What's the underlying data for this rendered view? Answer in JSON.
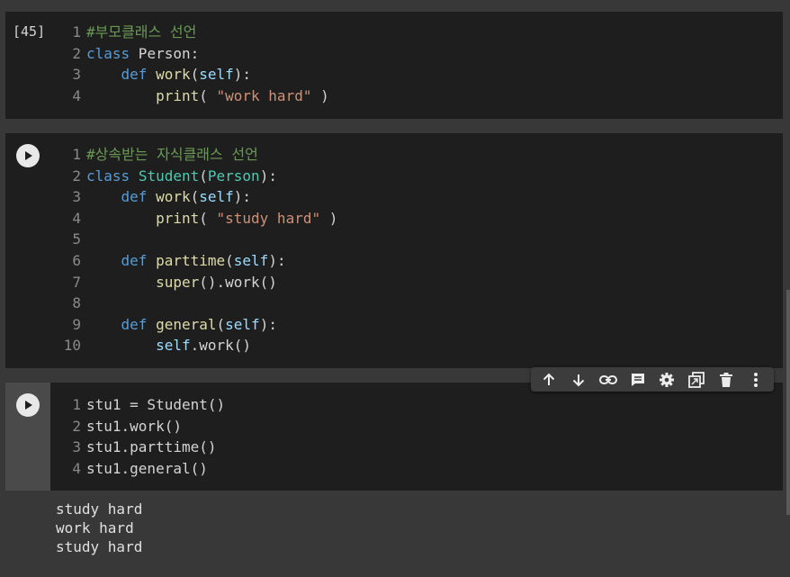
{
  "cells": [
    {
      "execution_count": "[45]",
      "lines": [
        [
          {
            "c": "cm",
            "t": "#부모클래스 선언"
          }
        ],
        [
          {
            "c": "kw",
            "t": "class"
          },
          {
            "c": "src",
            "t": " Person:"
          }
        ],
        [
          {
            "c": "src",
            "t": "    "
          },
          {
            "c": "kw",
            "t": "def"
          },
          {
            "c": "src",
            "t": " "
          },
          {
            "c": "fn",
            "t": "work"
          },
          {
            "c": "src",
            "t": "("
          },
          {
            "c": "sf",
            "t": "self"
          },
          {
            "c": "src",
            "t": "):"
          }
        ],
        [
          {
            "c": "src",
            "t": "        "
          },
          {
            "c": "fn",
            "t": "print"
          },
          {
            "c": "src",
            "t": "( "
          },
          {
            "c": "st",
            "t": "\"work hard\""
          },
          {
            "c": "src",
            "t": " )"
          }
        ]
      ]
    },
    {
      "lines": [
        [
          {
            "c": "cm",
            "t": "#상속받는 자식클래스 선언"
          }
        ],
        [
          {
            "c": "kw",
            "t": "class"
          },
          {
            "c": "src",
            "t": " "
          },
          {
            "c": "cls",
            "t": "Student"
          },
          {
            "c": "src",
            "t": "("
          },
          {
            "c": "cls",
            "t": "Person"
          },
          {
            "c": "src",
            "t": "):"
          }
        ],
        [
          {
            "c": "src",
            "t": "    "
          },
          {
            "c": "kw",
            "t": "def"
          },
          {
            "c": "src",
            "t": " "
          },
          {
            "c": "fn",
            "t": "work"
          },
          {
            "c": "src",
            "t": "("
          },
          {
            "c": "sf",
            "t": "self"
          },
          {
            "c": "src",
            "t": "):"
          }
        ],
        [
          {
            "c": "src",
            "t": "        "
          },
          {
            "c": "fn",
            "t": "print"
          },
          {
            "c": "src",
            "t": "( "
          },
          {
            "c": "st",
            "t": "\"study hard\""
          },
          {
            "c": "src",
            "t": " )"
          }
        ],
        [],
        [
          {
            "c": "src",
            "t": "    "
          },
          {
            "c": "kw",
            "t": "def"
          },
          {
            "c": "src",
            "t": " "
          },
          {
            "c": "fn",
            "t": "parttime"
          },
          {
            "c": "src",
            "t": "("
          },
          {
            "c": "sf",
            "t": "self"
          },
          {
            "c": "src",
            "t": "):"
          }
        ],
        [
          {
            "c": "src",
            "t": "        "
          },
          {
            "c": "fn",
            "t": "super"
          },
          {
            "c": "src",
            "t": "().work()"
          }
        ],
        [],
        [
          {
            "c": "src",
            "t": "    "
          },
          {
            "c": "kw",
            "t": "def"
          },
          {
            "c": "src",
            "t": " "
          },
          {
            "c": "fn",
            "t": "general"
          },
          {
            "c": "src",
            "t": "("
          },
          {
            "c": "sf",
            "t": "self"
          },
          {
            "c": "src",
            "t": "):"
          }
        ],
        [
          {
            "c": "src",
            "t": "        "
          },
          {
            "c": "sf",
            "t": "self"
          },
          {
            "c": "src",
            "t": ".work()"
          }
        ]
      ]
    },
    {
      "lines": [
        [
          {
            "c": "src",
            "t": "stu1 = Student()"
          }
        ],
        [
          {
            "c": "src",
            "t": "stu1.work()"
          }
        ],
        [
          {
            "c": "src",
            "t": "stu1.parttime()"
          }
        ],
        [
          {
            "c": "src",
            "t": "stu1.general()"
          }
        ]
      ],
      "output": [
        "study hard",
        "work hard",
        "study hard"
      ]
    }
  ],
  "toolbar_icons": [
    "arrow-up-icon",
    "arrow-down-icon",
    "link-icon",
    "comment-icon",
    "gear-icon",
    "mirror-cell-icon",
    "trash-icon",
    "more-vert-icon"
  ],
  "colors": {
    "background": "#383838",
    "cell": "#1e1e1e",
    "comment": "#6a9955",
    "keyword": "#569cd6",
    "function": "#dcdcaa",
    "class": "#4ec9b0",
    "string": "#ce9178"
  }
}
